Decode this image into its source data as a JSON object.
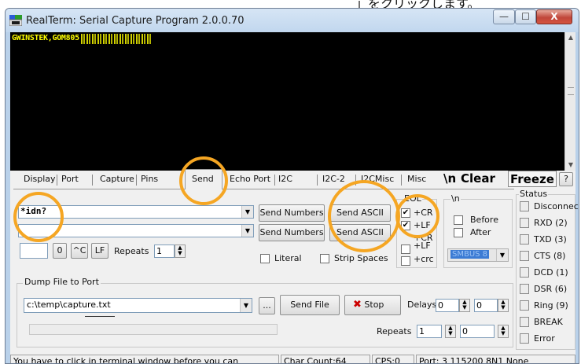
{
  "top_strip_text": "」をクリックします。",
  "window": {
    "title": "RealTerm: Serial Capture Program 2.0.0.70",
    "minimize": "—",
    "maximize": "☐",
    "close": "X"
  },
  "terminal": {
    "text": "GWINSTEK,GOM805"
  },
  "tabs": [
    "Display",
    "Port",
    "Capture",
    "Pins",
    "Send",
    "Echo Port",
    "I2C",
    "I2C-2",
    "I2CMisc",
    "Misc"
  ],
  "toolbar": {
    "newline_label": "\\n",
    "clear_label": "Clear",
    "freeze_label": "Freeze",
    "help_label": "?"
  },
  "send": {
    "input1_value": "*idn?",
    "input2_value": "",
    "send_numbers_1": "Send Numbers",
    "send_ascii_1": "Send ASCII",
    "send_numbers_2": "Send Numbers",
    "send_ascii_2": "Send ASCII",
    "num_field_value": "",
    "zero_label": "0",
    "ctrl_c_label": "^C",
    "lf_label": "LF",
    "repeats_label": "Repeats",
    "repeats_value": "1",
    "literal_label": "Literal",
    "strip_spaces_label": "Strip Spaces"
  },
  "eol": {
    "legend": "EOL",
    "cr_label": "+CR",
    "cr_checked": "✔",
    "lf_label": "+LF",
    "lf_checked": "✔",
    "cr2_label": "+CR",
    "lf2_label": "+LF",
    "crc_label": "+crc"
  },
  "newline_group": {
    "legend": "\\n",
    "before_label": "Before",
    "after_label": "After",
    "smbus_value": "SMBUS 8"
  },
  "dump": {
    "legend": "Dump File to Port",
    "file_path": "c:\\temp\\capture.txt",
    "browse_label": "...",
    "send_file_label": "Send File",
    "stop_label": "Stop",
    "delays_label": "Delays",
    "delay1": "0",
    "delay2": "0",
    "repeats_label": "Repeats",
    "repeats1": "1",
    "repeats2": "0"
  },
  "status": {
    "legend": "Status",
    "items": [
      "Disconnect",
      "RXD (2)",
      "TXD (3)",
      "CTS (8)",
      "DCD (1)",
      "DSR (6)",
      "Ring (9)",
      "BREAK",
      "Error"
    ]
  },
  "statusbar": {
    "message": "You have to click in terminal window before you can",
    "char_count": "Char Count:64",
    "cps": "CPS:0",
    "port": "Port: 3 115200 8N1 None"
  },
  "colors": {
    "highlight": "#f5a623",
    "terminal_text": "#ffff00",
    "terminal_bg": "#000000"
  }
}
